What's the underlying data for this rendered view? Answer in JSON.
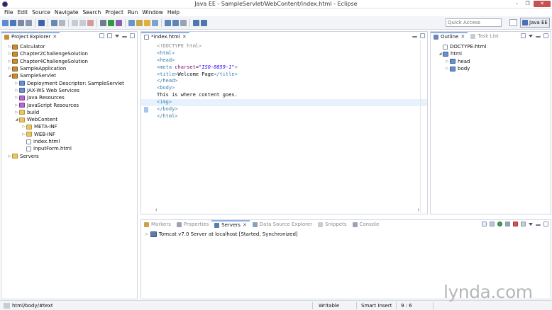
{
  "window": {
    "title": "Java EE - SampleServlet/WebContent/index.html - Eclipse",
    "min_glyph": "–",
    "max_glyph": "❐",
    "close_glyph": "✕"
  },
  "menu": [
    "File",
    "Edit",
    "Source",
    "Navigate",
    "Search",
    "Project",
    "Run",
    "Window",
    "Help"
  ],
  "toolbar": {
    "quick_access_placeholder": "Quick Access",
    "perspective_label": "Java EE"
  },
  "project_explorer": {
    "title": "Project Explorer",
    "close_glyph": "✕",
    "items": [
      {
        "label": "Calculator",
        "twisty": "▷",
        "icon": "project"
      },
      {
        "label": "Chapter2ChallengeSolution",
        "twisty": "▷",
        "icon": "project"
      },
      {
        "label": "Chapter4ChallengeSolution",
        "twisty": "▷",
        "icon": "project"
      },
      {
        "label": "SampleApplication",
        "twisty": "▷",
        "icon": "project"
      },
      {
        "label": "SampleServlet",
        "twisty": "◢",
        "icon": "project"
      },
      {
        "label": "Deployment Descriptor: SampleServlet",
        "twisty": "▷",
        "icon": "descriptor"
      },
      {
        "label": "JAX-WS Web Services",
        "twisty": "▷",
        "icon": "web-services"
      },
      {
        "label": "Java Resources",
        "twisty": "▷",
        "icon": "library"
      },
      {
        "label": "JavaScript Resources",
        "twisty": "▷",
        "icon": "library"
      },
      {
        "label": "build",
        "twisty": "▷",
        "icon": "folder"
      },
      {
        "label": "WebContent",
        "twisty": "◢",
        "icon": "folder"
      },
      {
        "label": "META-INF",
        "twisty": "▷",
        "icon": "folder"
      },
      {
        "label": "WEB-INF",
        "twisty": "▷",
        "icon": "folder"
      },
      {
        "label": "index.html",
        "twisty": "",
        "icon": "file"
      },
      {
        "label": "InputForm.html",
        "twisty": "",
        "icon": "file"
      },
      {
        "label": "Servers",
        "twisty": "▷",
        "icon": "folder"
      }
    ]
  },
  "editor": {
    "tab_label": "*index.html",
    "close_glyph": "✕",
    "lines": [
      [
        {
          "t": "<!DOCTYPE html>",
          "c": "doctype"
        }
      ],
      [
        {
          "t": "<html>",
          "c": "tag"
        }
      ],
      [
        {
          "t": "<head>",
          "c": "tag"
        }
      ],
      [
        {
          "t": "<meta ",
          "c": "tag"
        },
        {
          "t": "charset",
          "c": "attr"
        },
        {
          "t": "=",
          "c": "text"
        },
        {
          "t": "\"ISO-8859-1\"",
          "c": "val"
        },
        {
          "t": ">",
          "c": "tag"
        }
      ],
      [
        {
          "t": "<title>",
          "c": "tag"
        },
        {
          "t": "Welcome Page",
          "c": "text"
        },
        {
          "t": "</title>",
          "c": "tag"
        }
      ],
      [
        {
          "t": "</head>",
          "c": "tag"
        }
      ],
      [
        {
          "t": "<body>",
          "c": "tag"
        }
      ],
      [
        {
          "t": "This is where content goes.",
          "c": "text"
        }
      ],
      [
        {
          "t": "<img>",
          "c": "tag"
        }
      ],
      [
        {
          "t": "</body>",
          "c": "tag"
        }
      ],
      [
        {
          "t": "</html>",
          "c": "tag"
        }
      ]
    ],
    "current_line_index": 8
  },
  "outline": {
    "tabs": [
      {
        "label": "Outline",
        "active": true,
        "close_glyph": "✕"
      },
      {
        "label": "Task List",
        "active": false
      }
    ],
    "items": [
      {
        "label": "DOCTYPE:html",
        "twisty": "",
        "icon": "doctype"
      },
      {
        "label": "html",
        "twisty": "◢",
        "icon": "element"
      },
      {
        "label": "head",
        "twisty": "▷",
        "icon": "element"
      },
      {
        "label": "body",
        "twisty": "▷",
        "icon": "element"
      }
    ]
  },
  "bottom_panel": {
    "tabs": [
      {
        "label": "Markers",
        "active": false
      },
      {
        "label": "Properties",
        "active": false
      },
      {
        "label": "Servers",
        "active": true,
        "close_glyph": "✕"
      },
      {
        "label": "Data Source Explorer",
        "active": false
      },
      {
        "label": "Snippets",
        "active": false
      },
      {
        "label": "Console",
        "active": false
      }
    ],
    "servers": [
      {
        "label": "Tomcat v7.0 Server at localhost  [Started, Synchronized]",
        "twisty": "▷"
      }
    ]
  },
  "status_bar": {
    "path": "html/body/#text",
    "mode": "Writable",
    "insert_mode": "Smart Insert",
    "position": "9 : 6"
  },
  "watermark": "lynda.com",
  "colors": {
    "tag": "#3c7fa8",
    "attr": "#7f007f",
    "value": "#2a00ff",
    "current_line": "#e8f2fe",
    "active_tab_accent": "#8fb1e6"
  }
}
